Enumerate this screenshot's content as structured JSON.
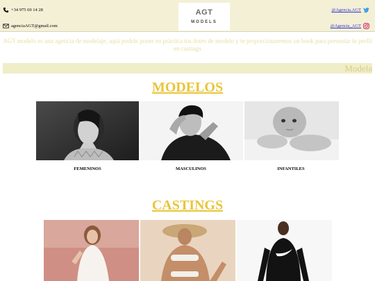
{
  "header": {
    "phone": "+34 975 69 14 28",
    "email": "agenciaAGT@gmail.com",
    "twitter": "@Agencia.AGT",
    "instagram": "@Agencia_AGT",
    "logo_top": "AGT",
    "logo_bottom": "MODELS",
    "icons": [
      "phone-icon",
      "mail-icon",
      "twitter-icon",
      "instagram-icon"
    ]
  },
  "intro": "AGT modelo es una agencia de modelaje, aqui podrás poner en práctica tus dotes de modelo y te proporcionaremos un book para presentar tu perfil en castings",
  "marquee": "Modela",
  "sections": {
    "modelos": {
      "title": "MODELOS",
      "items": [
        {
          "label": "FEMENINOS"
        },
        {
          "label": "MASCULINOS"
        },
        {
          "label": "INFANTILES"
        }
      ]
    },
    "castings": {
      "title": "CASTINGS"
    }
  },
  "colors": {
    "header_bg": "#f3f0d6",
    "accent_gold": "#e8c53a",
    "link": "#3333cc"
  }
}
